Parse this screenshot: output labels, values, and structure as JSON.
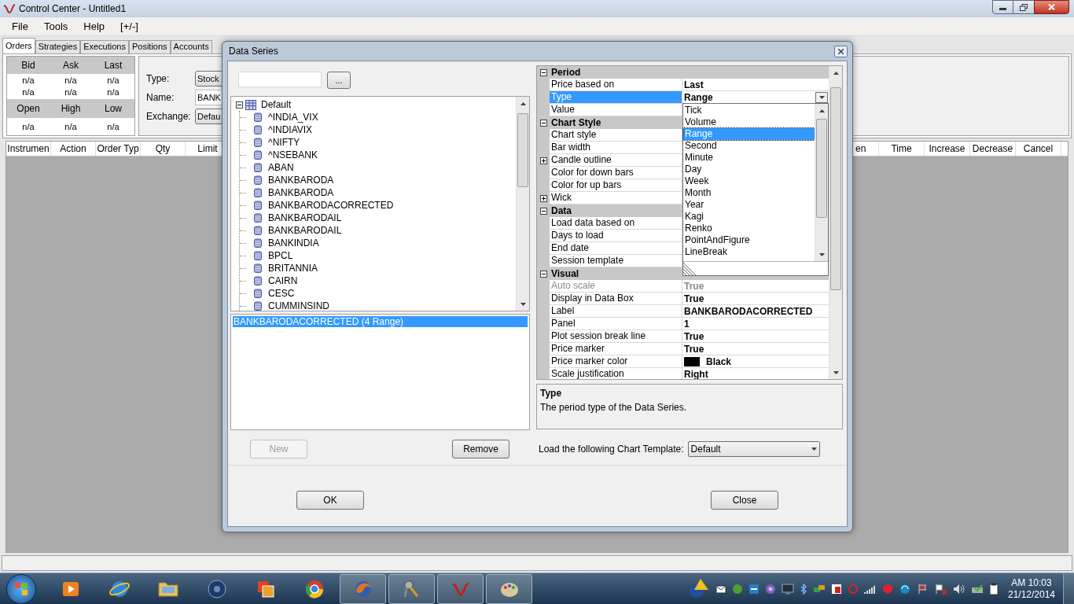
{
  "window": {
    "title": "Control Center - Untitled1"
  },
  "menu": [
    "File",
    "Tools",
    "Help",
    "[+/-]"
  ],
  "tabs": [
    {
      "label": "Orders",
      "selected": true
    },
    {
      "label": "Strategies",
      "selected": false
    },
    {
      "label": "Executions",
      "selected": false
    },
    {
      "label": "Positions",
      "selected": false
    },
    {
      "label": "Accounts",
      "selected": false
    }
  ],
  "quote": {
    "headers_top": [
      "Bid",
      "Ask",
      "Last"
    ],
    "rows_top": [
      [
        "n/a",
        "n/a",
        "n/a"
      ],
      [
        "n/a",
        "n/a",
        "n/a"
      ]
    ],
    "headers_bottom": [
      "Open",
      "High",
      "Low"
    ],
    "rows_bottom": [
      [
        "n/a",
        "n/a",
        "n/a"
      ]
    ]
  },
  "order_entry": [
    {
      "label": "Type:",
      "value": "Stock",
      "kind": "dropdown"
    },
    {
      "label": "Name:",
      "value": "BANK",
      "kind": "text"
    },
    {
      "label": "Exchange:",
      "value": "Defau",
      "kind": "dropdown"
    }
  ],
  "orders_table": {
    "columns_left": [
      "Instrumen",
      "Action",
      "Order Typ",
      "Qty",
      "Limit"
    ],
    "columns_right": [
      "en",
      "Time",
      "Increase",
      "Decrease",
      "Cancel"
    ]
  },
  "dialog": {
    "title": "Data Series",
    "browse_button": "...",
    "tree": {
      "label": "Default",
      "expanded": true,
      "children": [
        {
          "label": "^INDIA_VIX"
        },
        {
          "label": "^INDIAVIX"
        },
        {
          "label": "^NIFTY"
        },
        {
          "label": "^NSEBANK"
        },
        {
          "label": "ABAN"
        },
        {
          "label": "BANKBARODA"
        },
        {
          "label": "BANKBARODA"
        },
        {
          "label": "BANKBARODACORRECTED"
        },
        {
          "label": "BANKBARODAIL"
        },
        {
          "label": "BANKBARODAIL"
        },
        {
          "label": "BANKINDIA"
        },
        {
          "label": "BPCL"
        },
        {
          "label": "BRITANNIA"
        },
        {
          "label": "CAIRN"
        },
        {
          "label": "CESC"
        },
        {
          "label": "CUMMINSIND"
        }
      ]
    },
    "series_list": [
      {
        "label": "BANKBARODACORRECTED (4 Range)",
        "selected": true
      }
    ],
    "new_button": {
      "label": "New",
      "disabled": true
    },
    "remove_button": {
      "label": "Remove",
      "disabled": false
    },
    "properties": [
      {
        "category": "Period",
        "expanded": true,
        "rows": [
          {
            "name": "Price based on",
            "value": "Last",
            "selected": false,
            "kind": "property",
            "disabled": false
          },
          {
            "name": "Type",
            "value": "Range",
            "selected": true,
            "kind": "property",
            "disabled": false
          },
          {
            "name": "Value",
            "selected": false,
            "kind": "property",
            "disabled": false
          }
        ]
      },
      {
        "category": "Chart Style",
        "expanded": true,
        "rows": [
          {
            "name": "Chart style",
            "selected": false,
            "kind": "property",
            "disabled": false
          },
          {
            "name": "Bar width",
            "selected": false,
            "kind": "property",
            "disabled": false
          },
          {
            "name": "Candle outline",
            "selected": false,
            "kind": "group",
            "disabled": false
          },
          {
            "name": "Color for down bars",
            "selected": false,
            "kind": "property",
            "disabled": false
          },
          {
            "name": "Color for up bars",
            "selected": false,
            "kind": "property",
            "disabled": false
          },
          {
            "name": "Wick",
            "selected": false,
            "kind": "group",
            "disabled": false
          }
        ]
      },
      {
        "category": "Data",
        "expanded": true,
        "rows": [
          {
            "name": "Load data based on",
            "selected": false,
            "kind": "property",
            "disabled": false
          },
          {
            "name": "Days to load",
            "selected": false,
            "kind": "property",
            "disabled": false
          },
          {
            "name": "End date",
            "selected": false,
            "kind": "property",
            "disabled": false
          },
          {
            "name": "Session template",
            "selected": false,
            "kind": "property",
            "disabled": false
          }
        ]
      },
      {
        "category": "Visual",
        "expanded": true,
        "rows": [
          {
            "name": "Auto scale",
            "value": "True",
            "selected": false,
            "kind": "property",
            "disabled": true
          },
          {
            "name": "Display in Data Box",
            "value": "True",
            "selected": false,
            "kind": "property",
            "disabled": false
          },
          {
            "name": "Label",
            "value": "BANKBARODACORRECTED",
            "selected": false,
            "kind": "property",
            "disabled": false
          },
          {
            "name": "Panel",
            "value": "1",
            "selected": false,
            "kind": "property",
            "disabled": false
          },
          {
            "name": "Plot session break line",
            "value": "True",
            "selected": false,
            "kind": "property",
            "disabled": false
          },
          {
            "name": "Price marker",
            "value": "True",
            "selected": false,
            "kind": "property",
            "disabled": false
          },
          {
            "name": "Price marker color",
            "value": "Black",
            "color": "#000000",
            "selected": false,
            "kind": "property",
            "disabled": false
          },
          {
            "name": "Scale justification",
            "value": "Right",
            "selected": false,
            "kind": "property",
            "disabled": false
          }
        ]
      }
    ],
    "type_dropdown": [
      {
        "label": "Tick",
        "selected": false
      },
      {
        "label": "Volume",
        "selected": false
      },
      {
        "label": "Range",
        "selected": true
      },
      {
        "label": "Second",
        "selected": false
      },
      {
        "label": "Minute",
        "selected": false
      },
      {
        "label": "Day",
        "selected": false
      },
      {
        "label": "Week",
        "selected": false
      },
      {
        "label": "Month",
        "selected": false
      },
      {
        "label": "Year",
        "selected": false
      },
      {
        "label": "Kagi",
        "selected": false
      },
      {
        "label": "Renko",
        "selected": false
      },
      {
        "label": "PointAndFigure",
        "selected": false
      },
      {
        "label": "LineBreak",
        "selected": false
      }
    ],
    "description": {
      "title": "Type",
      "text": "The period type of the Data Series."
    },
    "template": {
      "label": "Load the following Chart Template:",
      "value": "Default"
    },
    "ok_button": "OK",
    "close_button": "Close"
  },
  "taskbar": {
    "time": "AM 10:03",
    "date": "21/12/2014"
  }
}
